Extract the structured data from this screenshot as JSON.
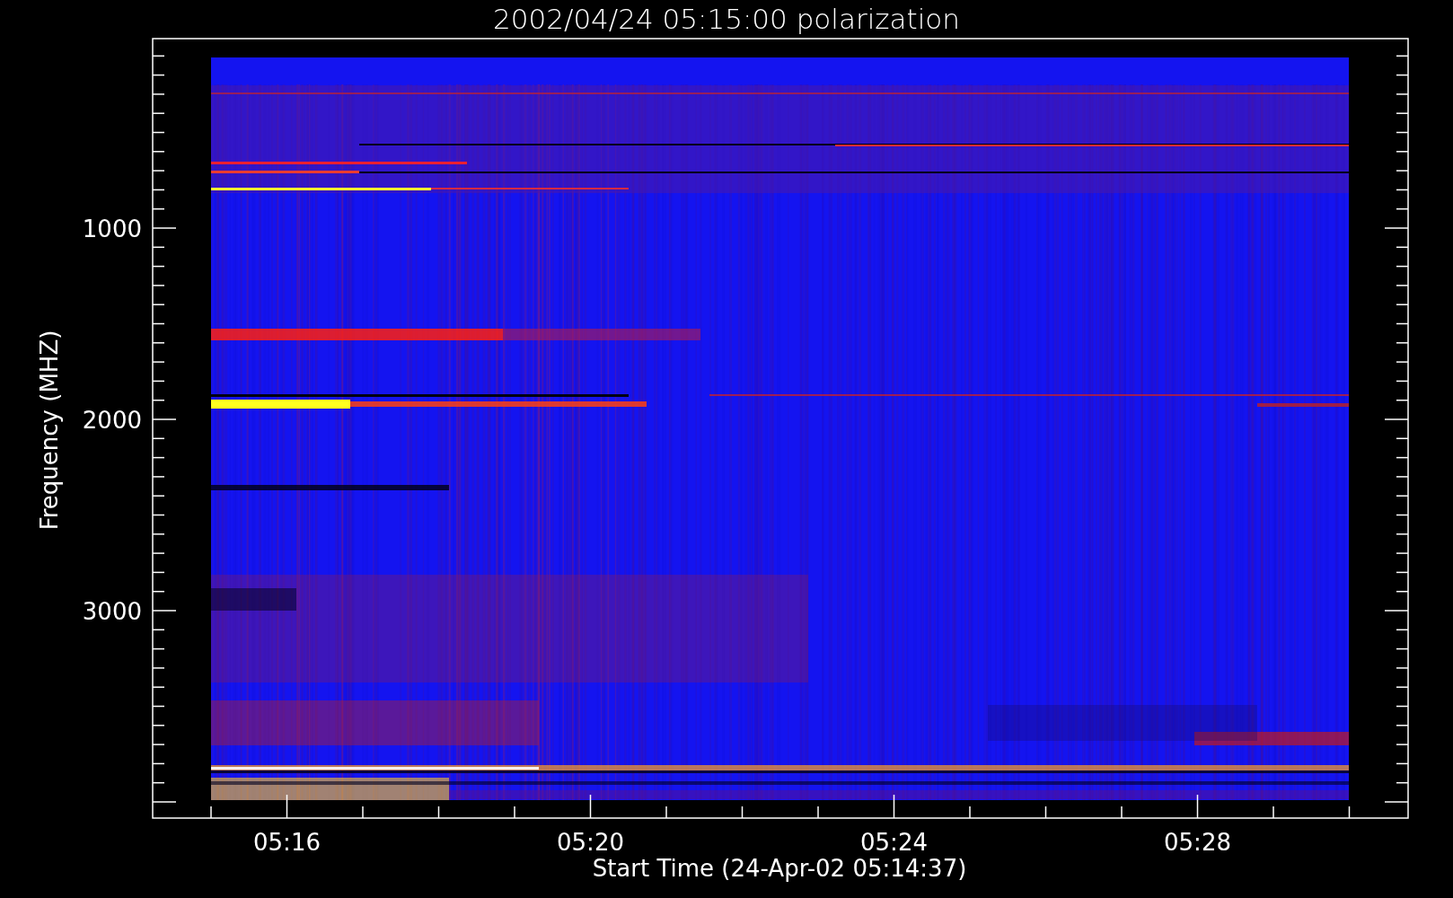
{
  "title": "2002/04/24 05:15:00 polarization",
  "x_axis": {
    "label": "Start Time (24-Apr-02 05:14:37)",
    "ticks": [
      "05:16",
      "05:20",
      "05:24",
      "05:28"
    ]
  },
  "y_axis": {
    "label": "Frequency (MHZ)",
    "ticks": [
      "1000",
      "2000",
      "3000"
    ]
  }
}
